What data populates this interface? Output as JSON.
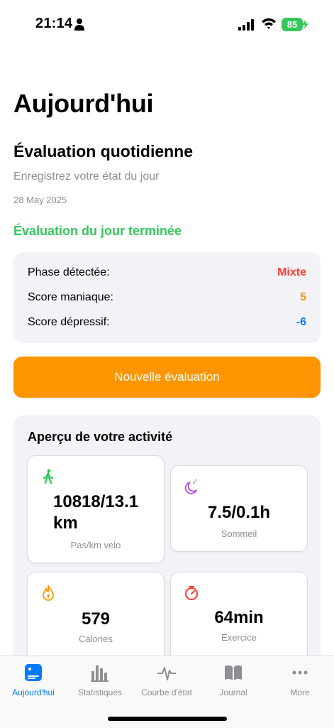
{
  "status_bar": {
    "time": "21:14",
    "battery": "85"
  },
  "header": {
    "title": "Aujourd'hui"
  },
  "evaluation": {
    "title": "Évaluation quotidienne",
    "subtitle": "Enregistrez votre état du jour",
    "date": "28 May 2025",
    "status": "Évaluation du jour terminée"
  },
  "scores": [
    {
      "label": "Phase détectée:",
      "value": "Mixte",
      "color": "#ff3b30"
    },
    {
      "label": "Score maniaque:",
      "value": "5",
      "color": "#ff9500"
    },
    {
      "label": "Score dépressif:",
      "value": "-6",
      "color": "#007aff"
    }
  ],
  "new_eval_button": "Nouvelle évaluation",
  "activity": {
    "title": "Aperçu de votre activité",
    "tiles": [
      {
        "icon": "walk-icon",
        "value": "10818/13.1 km",
        "label": "Pas/km velo",
        "color": "#34c759"
      },
      {
        "icon": "moon-sleep-icon",
        "value": "7.5/0.1h",
        "label": "Sommeil",
        "color": "#af52de"
      },
      {
        "icon": "flame-icon",
        "value": "579",
        "label": "Calories",
        "color": "#ff9500"
      },
      {
        "icon": "timer-icon",
        "value": "64min",
        "label": "Exercice",
        "color": "#ff3b30"
      }
    ]
  },
  "tabs": [
    {
      "label": "Aujourd'hui",
      "icon": "today-icon",
      "active": true
    },
    {
      "label": "Statistiques",
      "icon": "bar-chart-icon",
      "active": false
    },
    {
      "label": "Courbe d'état",
      "icon": "waveform-icon",
      "active": false
    },
    {
      "label": "Journal",
      "icon": "book-icon",
      "active": false
    },
    {
      "label": "More",
      "icon": "more-icon",
      "active": false
    }
  ],
  "colors": {
    "accent": "#007aff",
    "orange": "#ff9500",
    "green": "#34c759"
  }
}
